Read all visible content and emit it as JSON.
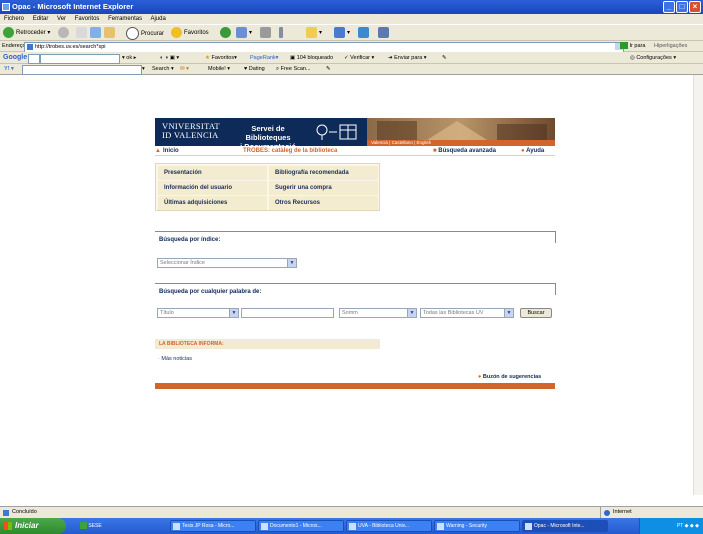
{
  "window": {
    "title": "Opac - Microsoft Internet Explorer"
  },
  "menu": [
    "Fichero",
    "Editar",
    "Ver",
    "Favoritos",
    "Ferramentas",
    "Ajuda"
  ],
  "toolbar": {
    "back": "Retroceder",
    "search": "Procurar",
    "favorites": "Favoritos"
  },
  "address": {
    "label": "Endereço",
    "url": "http://trobes.uv.es/search*spi",
    "go": "Ir para",
    "links": "Hiperligações"
  },
  "google": {
    "search": "Search",
    "blocked": "104 bloqueado",
    "check": "Verificar",
    "send": "Enviar para",
    "settings": "Configurações"
  },
  "toolbar2": {
    "search": "Search",
    "mobile": "Mobile!",
    "dating": "Dating",
    "freescan": "Free Scan..."
  },
  "banner": {
    "uv_line1": "VNIVERSITAT",
    "uv_line2": "ID VALENCIA",
    "service_line1": "Servei de Biblioteques",
    "service_line2": "i Documentació",
    "campus": "Valencià | Castellano | English"
  },
  "nav": {
    "home": "Inicio",
    "catalog_title": "TROBES: catàleg de la biblioteca",
    "advanced": "Búsqueda avanzada",
    "help": "Ayuda"
  },
  "menu_links": [
    "Presentación",
    "Bibliografía recomendada",
    "Información del usuario",
    "Sugerir una compra",
    "Últimas adquisiciones",
    "Otros Recursos"
  ],
  "index_search": {
    "title": "Búsqueda por índice:",
    "select": "Seleccionar Índice"
  },
  "word_search": {
    "title": "Búsqueda por cualquier palabra de:",
    "field": "Título",
    "value": "",
    "mode": "Somm",
    "libraries": "Todas las Bibliotecas UV",
    "button": "Buscar"
  },
  "info": {
    "header": "LA BIBLIOTECA INFORMA:",
    "more": "Más noticias"
  },
  "suggestions": "Buzón de sugerencias",
  "status": {
    "left": "Concluído",
    "right": "Internet"
  },
  "taskbar": {
    "start": "Iniciar",
    "quick": "SESE",
    "tasks": [
      "Tesis JP Rosa - Micro...",
      "Documento1 - Micros...",
      "UVA - Biblioteca Univ...",
      "Warning - Security",
      "Opac - Microsoft Inte..."
    ],
    "tray": "PT"
  }
}
